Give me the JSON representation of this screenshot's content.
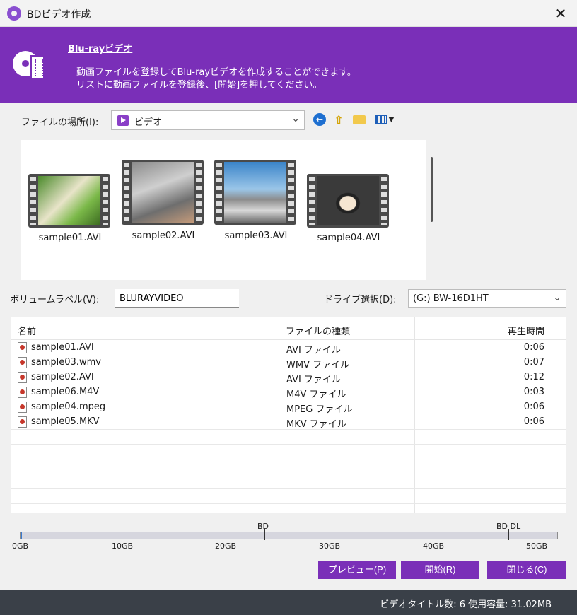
{
  "window": {
    "title": "BDビデオ作成",
    "close_glyph": "✕"
  },
  "banner": {
    "heading": "Blu-rayビデオ",
    "line1": "動画ファイルを登録してBlu-rayビデオを作成することができます。",
    "line2": "リストに動画ファイルを登録後、[開始]を押してください。",
    "color": "#7a2fb8"
  },
  "location": {
    "label": "ファイルの場所(I):",
    "value": "ビデオ"
  },
  "thumbnails": [
    {
      "name": "sample01.AVI"
    },
    {
      "name": "sample02.AVI"
    },
    {
      "name": "sample03.AVI"
    },
    {
      "name": "sample04.AVI"
    }
  ],
  "volume": {
    "label": "ボリュームラベル(V):",
    "value": "BLURAYVIDEO"
  },
  "drive": {
    "label": "ドライブ選択(D):",
    "value": "(G:) BW-16D1HT"
  },
  "list": {
    "columns": [
      "名前",
      "ファイルの種類",
      "再生時間"
    ],
    "rows": [
      {
        "name": "sample01.AVI",
        "type": "AVI ファイル",
        "duration": "0:06"
      },
      {
        "name": "sample03.wmv",
        "type": "WMV ファイル",
        "duration": "0:07"
      },
      {
        "name": "sample02.AVI",
        "type": "AVI ファイル",
        "duration": "0:12"
      },
      {
        "name": "sample06.M4V",
        "type": "M4V ファイル",
        "duration": "0:03"
      },
      {
        "name": "sample04.mpeg",
        "type": "MPEG ファイル",
        "duration": "0:06"
      },
      {
        "name": "sample05.MKV",
        "type": "MKV ファイル",
        "duration": "0:06"
      }
    ]
  },
  "capacity": {
    "marks": [
      "BD",
      "BD DL"
    ],
    "ticks": [
      "0GB",
      "10GB",
      "20GB",
      "30GB",
      "40GB",
      "50GB"
    ],
    "used_gb": 0.03
  },
  "buttons": {
    "preview": "プレビュー(P)",
    "start": "開始(R)",
    "close": "閉じる(C)"
  },
  "status": {
    "text": "ビデオタイトル数: 6  使用容量: 31.02MB"
  }
}
